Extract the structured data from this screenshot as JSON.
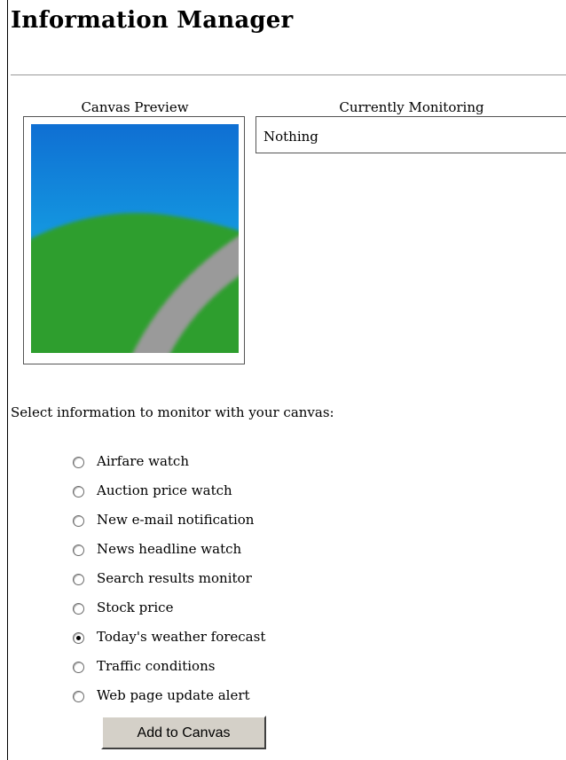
{
  "page": {
    "title": "Information Manager"
  },
  "preview": {
    "heading": "Canvas Preview",
    "colors": {
      "sky_top": "#0f6fd3",
      "sky_horizon": "#19c2ee",
      "grass": "#2f9e2f",
      "road": "#9a9a9a"
    }
  },
  "monitoring": {
    "heading": "Currently Monitoring",
    "value": "Nothing"
  },
  "selection": {
    "prompt": "Select information to monitor with your canvas:",
    "options": [
      {
        "label": "Airfare watch",
        "checked": false
      },
      {
        "label": "Auction price watch",
        "checked": false
      },
      {
        "label": "New e-mail notification",
        "checked": false
      },
      {
        "label": "News headline watch",
        "checked": false
      },
      {
        "label": "Search results monitor",
        "checked": false
      },
      {
        "label": "Stock price",
        "checked": false
      },
      {
        "label": "Today's weather forecast",
        "checked": true
      },
      {
        "label": "Traffic conditions",
        "checked": false
      },
      {
        "label": "Web page update alert",
        "checked": false
      }
    ],
    "button_label": "Add to Canvas"
  }
}
